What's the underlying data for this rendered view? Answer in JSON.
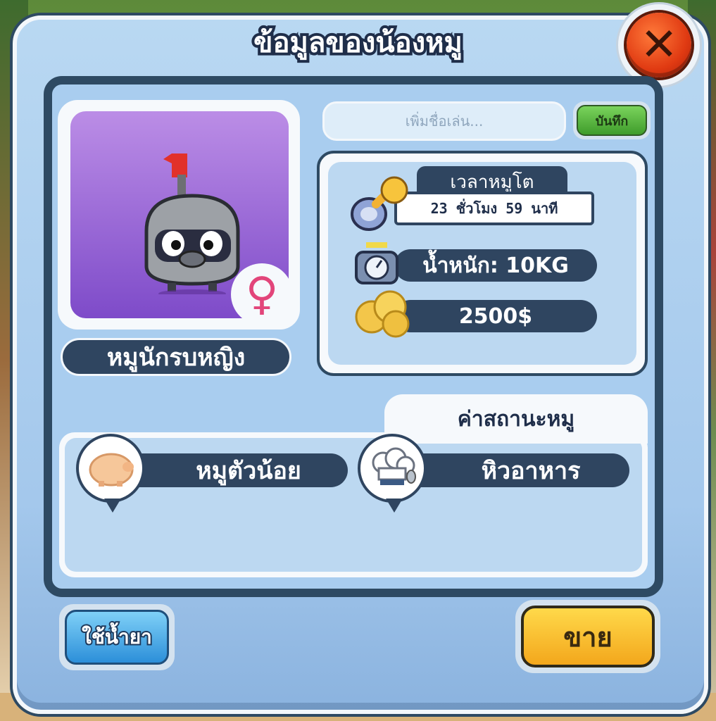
{
  "dialog": {
    "title": "ข้อมูลของน้องหมู",
    "close_icon": "close-x-icon"
  },
  "pig": {
    "name": "หมูนักรบหญิง",
    "gender_icon": "female-icon",
    "name_input_placeholder": "เพิ่มชื่อเล่น...",
    "save_label": "บันทึก"
  },
  "stats": {
    "growth_time_label": "เวลาหมูโต",
    "growth_time_value": "23 ชั่วโมง 59 นาที",
    "weight": "น้ำหนัก: 10KG",
    "price": "2500$"
  },
  "status": {
    "header": "ค่าสถานะหมู",
    "items": [
      {
        "icon": "piglet-icon",
        "label": "หมูตัวน้อย"
      },
      {
        "icon": "chef-hat-icon",
        "label": "หิวอาหาร"
      }
    ]
  },
  "actions": {
    "medicine_label": "ใช้น้ำยา",
    "sell_label": "ขาย"
  },
  "colors": {
    "panel_blue": "#a9cdef",
    "dark_navy": "#2f4560",
    "sell_yellow": "#ffd94a",
    "medicine_blue": "#2c8fd9",
    "save_green": "#3f9c2b",
    "close_red": "#e03a12"
  }
}
